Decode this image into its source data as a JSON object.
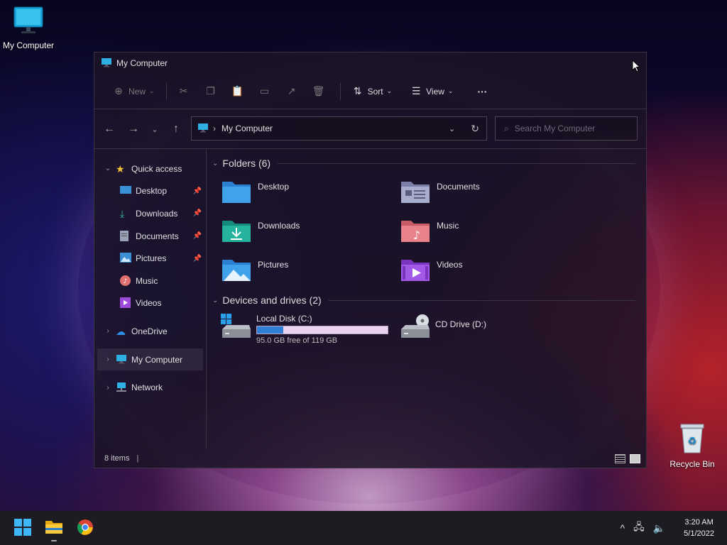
{
  "desktop": {
    "my_computer_label": "My Computer",
    "recycle_bin_label": "Recycle Bin"
  },
  "window": {
    "title": "My Computer",
    "toolbar": {
      "new_label": "New",
      "sort_label": "Sort",
      "view_label": "View",
      "more_label": "···"
    },
    "address": {
      "path": "My Computer",
      "search_placeholder": "Search My Computer"
    },
    "sidebar": {
      "quick_access": "Quick access",
      "items": [
        {
          "label": "Desktop",
          "icon": "desktop-icon"
        },
        {
          "label": "Downloads",
          "icon": "downloads-icon"
        },
        {
          "label": "Documents",
          "icon": "documents-icon"
        },
        {
          "label": "Pictures",
          "icon": "pictures-icon"
        },
        {
          "label": "Music",
          "icon": "music-icon"
        },
        {
          "label": "Videos",
          "icon": "videos-icon"
        }
      ],
      "onedrive": "OneDrive",
      "my_computer": "My Computer",
      "network": "Network"
    },
    "folders": {
      "heading": "Folders (6)",
      "items": [
        "Desktop",
        "Documents",
        "Downloads",
        "Music",
        "Pictures",
        "Videos"
      ]
    },
    "drives": {
      "heading": "Devices and drives (2)",
      "local": {
        "name": "Local Disk (C:)",
        "free_text": "95.0 GB free of 119 GB",
        "used_fraction": 0.2
      },
      "cd": {
        "name": "CD Drive (D:)"
      }
    },
    "status": {
      "items": "8 items",
      "sep": "|"
    }
  },
  "taskbar": {
    "time": "3:20 AM",
    "date": "5/1/2022"
  },
  "colors": {
    "accent": "#2f7fd6",
    "window_bg": "#1c1426"
  }
}
